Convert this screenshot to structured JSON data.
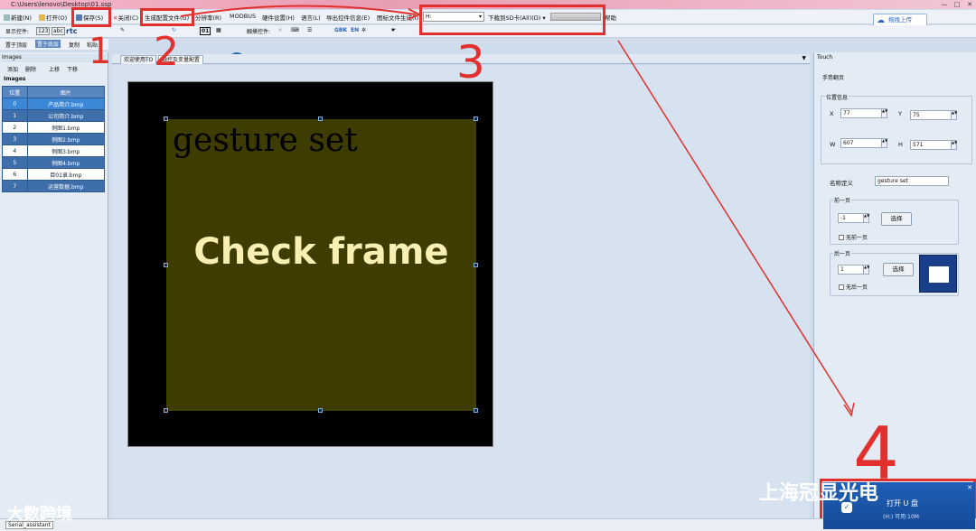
{
  "window": {
    "title": "C:\\Users\\lenovo\\Desktop\\01.ssp",
    "controls": [
      "—",
      "□",
      "✕"
    ]
  },
  "menubar": {
    "items": [
      "新建(N)",
      "打开(O)",
      "保存(S)",
      "关闭(C)",
      "生成配置文件(G)",
      "分辨率(R)",
      "MODBUS",
      "硬件设置(H)",
      "语言(L)",
      "导出控件信息(E)",
      "图标文件生成(I)",
      "H:",
      "下载到SD卡(All)(D)",
      "帮助"
    ],
    "upload_button": "拖拽上传"
  },
  "toolbar": {
    "display_label": "显示控件:",
    "touch_label": "触摸控件:",
    "gbk": "GBK",
    "en": "EN",
    "num": "01"
  },
  "toolbar3": [
    "置于顶层",
    "置于底层",
    "复制",
    "粘贴"
  ],
  "annotations": [
    "1",
    "2",
    "3",
    "4"
  ],
  "images_panel": {
    "title": "Images",
    "tools": [
      "添加",
      "删除",
      "上移",
      "下移"
    ],
    "subhead": "Images",
    "headers": [
      "位置",
      "图片"
    ],
    "rows": [
      [
        "0",
        "产品简介.bmp"
      ],
      [
        "1",
        "公司简介.bmp"
      ],
      [
        "2",
        "例图1.bmp"
      ],
      [
        "3",
        "例图2.bmp"
      ],
      [
        "4",
        "例图3.bmp"
      ],
      [
        "5",
        "例图4.bmp"
      ],
      [
        "6",
        "目01录.bmp"
      ],
      [
        "7",
        "运营数据.bmp"
      ]
    ]
  },
  "tabs": [
    "欢迎使用TO",
    "触控及变量配置"
  ],
  "canvas": {
    "gesture_text": "gesture set",
    "check_text": "Check frame"
  },
  "touch_panel": {
    "title": "Touch",
    "section": "手势翻页",
    "position_group": "位置信息",
    "x_label": "X",
    "x_value": "77",
    "y_label": "Y",
    "y_value": "75",
    "w_label": "W",
    "w_value": "607",
    "h_label": "H",
    "h_value": "571",
    "name_label": "名称定义",
    "name_value": "gesture set",
    "prev_group": "前一页",
    "prev_value": "-1",
    "prev_button": "选择",
    "prev_check": "无前一页",
    "next_group": "后一页",
    "next_value": "1",
    "next_button": "选择",
    "next_check": "无后一页"
  },
  "status": {
    "tab": "Serial_assistant"
  },
  "popup": {
    "title": "打开 U 盘",
    "detail": "(H:)  可用:10M"
  },
  "watermarks": {
    "left": "大数跨境",
    "right": "上海冠显光电"
  }
}
